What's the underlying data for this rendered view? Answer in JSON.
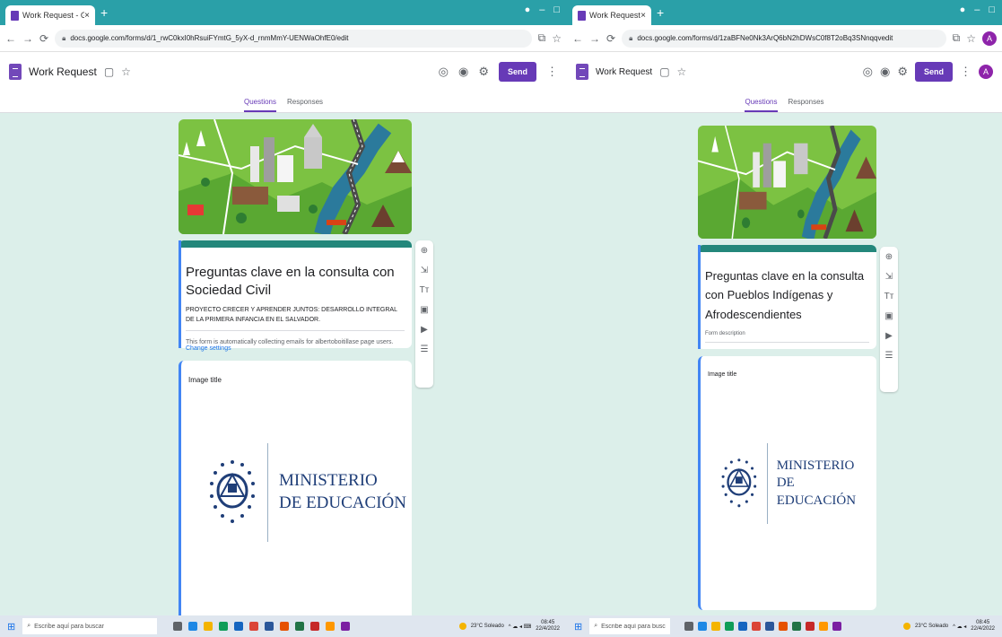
{
  "colors": {
    "accent": "#673ab7",
    "form_header": "#23877b",
    "background": "#dcefea",
    "focus": "#4285f4"
  },
  "left": {
    "tab_title": "Work Request - Google Forms",
    "url": "docs.google.com/forms/d/1_rwC0kxI0hRsuiFYmtG_5yX-d_rnmMmY-UENWaOhfE0/edit",
    "doc_title": "Work Request",
    "send_label": "Send",
    "subtabs": [
      "Questions",
      "Responses"
    ],
    "form_title": "Preguntas clave en la consulta con Sociedad Civil",
    "form_description": "PROYECTO CRECER Y APRENDER JUNTOS: DESARROLLO INTEGRAL DE LA PRIMERA INFANCIA EN EL SALVADOR.",
    "email_note": "This form is automatically collecting emails for albertoboitillase page users.",
    "email_link": "Change settings",
    "image_title": "Image title",
    "ministry_line1": "MINISTERIO",
    "ministry_line2": "DE EDUCACIÓN"
  },
  "right": {
    "tab_title": "Work Request - Google Forms",
    "url": "docs.google.com/forms/d/1zaBFNe0Nk3ArQ6bN2hDWsC0f8T2oBq3SNnqqvedit",
    "doc_title": "Work Request",
    "send_label": "Send",
    "avatar_letter": "A",
    "subtabs": [
      "Questions",
      "Responses"
    ],
    "form_title": "Preguntas clave en la consulta con Pueblos Indígenas y Afrodescendientes",
    "form_description_placeholder": "Form description",
    "image_title": "Image title",
    "ministry_line1": "MINISTERIO",
    "ministry_line2": "DE EDUCACIÓN"
  },
  "taskbar": {
    "search_placeholder": "Escribe aquí para buscar",
    "weather": "23°C Soleado",
    "time": "08:45",
    "date": "22/4/2022"
  }
}
